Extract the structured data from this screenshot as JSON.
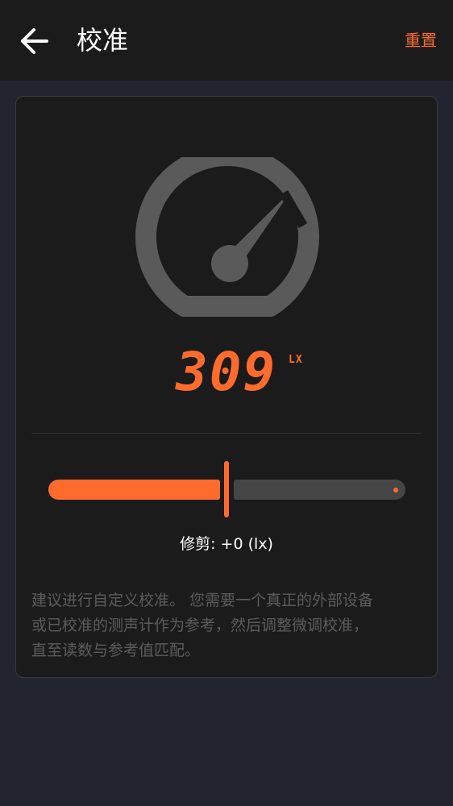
{
  "header": {
    "title": "校准",
    "reset_label": "重置"
  },
  "meter": {
    "value": "309",
    "unit": "LX"
  },
  "trim": {
    "label": "修剪: +0 (lx)",
    "level_fraction": 0.5
  },
  "help_text": {
    "line1": "建议进行自定义校准。 您需要一个真正的外部设备",
    "line2": "或已校准的测声计作为参考，然后调整微调校准，",
    "line3": "直至读数与参考值匹配。"
  },
  "colors": {
    "accent": "#ff6b2c",
    "gauge": "#5a5a5a",
    "app_bar": "#1b1b1b",
    "background": "#222430"
  },
  "icons": {
    "back": "arrow-left-icon",
    "gauge": "speedometer-icon"
  }
}
